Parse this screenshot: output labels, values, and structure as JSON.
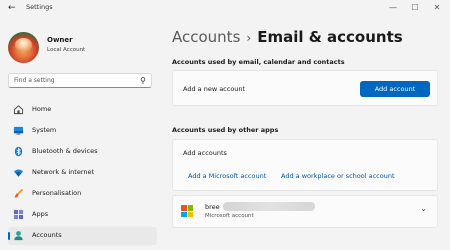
{
  "window": {
    "title": "Settings",
    "back_glyph": "←",
    "minimize_glyph": "—",
    "maximize_glyph": "☐",
    "close_glyph": "✕"
  },
  "profile": {
    "name": "Owner",
    "account_type": "Local Account"
  },
  "search": {
    "placeholder": "Find a setting",
    "icon": "search-icon"
  },
  "sidebar": {
    "items": [
      {
        "label": "Home",
        "icon": "home-icon"
      },
      {
        "label": "System",
        "icon": "system-icon"
      },
      {
        "label": "Bluetooth & devices",
        "icon": "bluetooth-icon"
      },
      {
        "label": "Network & internet",
        "icon": "wifi-icon"
      },
      {
        "label": "Personalisation",
        "icon": "brush-icon"
      },
      {
        "label": "Apps",
        "icon": "apps-icon"
      },
      {
        "label": "Accounts",
        "icon": "accounts-icon",
        "active": true
      }
    ]
  },
  "breadcrumb": {
    "parent": "Accounts",
    "separator": "›",
    "current": "Email & accounts"
  },
  "email_section": {
    "title": "Accounts used by email, calendar and contacts",
    "add_label": "Add a new account",
    "add_button": "Add account"
  },
  "other_section": {
    "title": "Accounts used by other apps",
    "add_label": "Add accounts",
    "link_microsoft": "Add a Microsoft account",
    "link_work": "Add a workplace or school account"
  },
  "account": {
    "name": "bree",
    "type": "Microsoft account",
    "chevron": "⌄"
  },
  "colors": {
    "accent": "#0067c0",
    "link": "#0055a8",
    "background": "#f3f3f3",
    "card": "#fbfbfb"
  }
}
